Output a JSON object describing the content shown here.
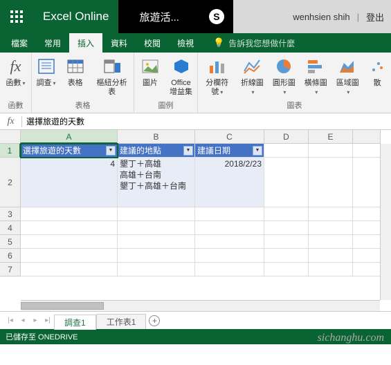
{
  "topbar": {
    "app_title": "Excel Online",
    "doc_title": "旅遊活...",
    "user": "wenhsien shih",
    "signin": "登出"
  },
  "tabs": {
    "file": "檔案",
    "home": "常用",
    "insert": "插入",
    "data": "資料",
    "review": "校閱",
    "view": "檢視",
    "tellme": "告訴我您想做什麼"
  },
  "ribbon": {
    "fx_btn": "函數",
    "fx_group": "函數",
    "survey": "調查",
    "table": "表格",
    "pivot": "樞紐分析表",
    "table_group": "表格",
    "image": "圖片",
    "addins": "Office\n增益集",
    "img_group": "圖例",
    "sep": "分欄符號",
    "line_chart": "折線圖",
    "pie_chart": "圓形圖",
    "bar_chart": "橫條圖",
    "area_chart": "區域圖",
    "scatter": "散",
    "chart_group": "圖表"
  },
  "formula": {
    "fx": "fx",
    "value": "選擇旅遊的天數"
  },
  "cols": [
    "A",
    "B",
    "C",
    "D",
    "E"
  ],
  "rows": [
    "1",
    "2",
    "3",
    "4",
    "5",
    "6",
    "7"
  ],
  "table": {
    "h1": "選擇旅遊的天數",
    "h2": "建議的地點",
    "h3": "建議日期",
    "a2": "4",
    "b2": "墾丁＋高雄\n高雄＋台南\n墾丁＋高雄＋台南",
    "c2": "2018/2/23"
  },
  "sheets": {
    "s1": "調查1",
    "s2": "工作表1"
  },
  "status": {
    "left": "已儲存至 ONEDRIVE"
  },
  "watermark": "sichanghu.com"
}
